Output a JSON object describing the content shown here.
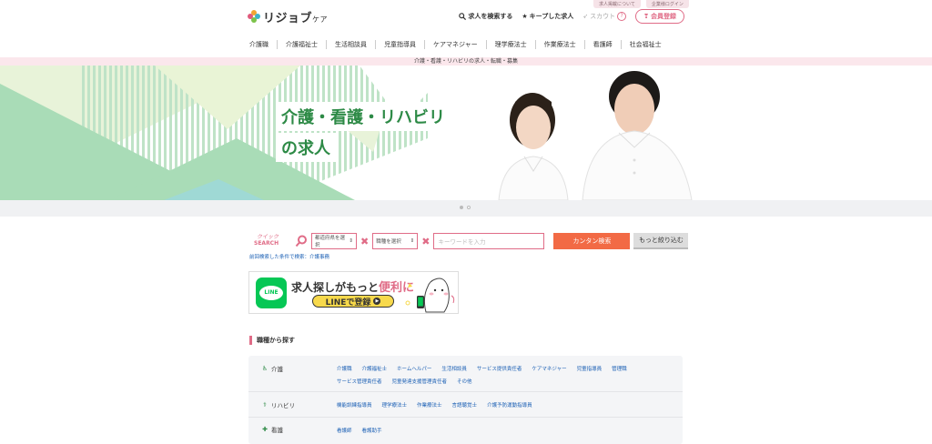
{
  "top_links": [
    "求人掲載について",
    "企業様ログイン"
  ],
  "header": {
    "logo_text": "リジョブ",
    "logo_sub": "ケア",
    "search_link": "求人を検索する",
    "keep_link": "キープした求人",
    "scout_link": "スカウト",
    "help_icon": "?",
    "register": "会員登録"
  },
  "nav": [
    "介護職",
    "介護福祉士",
    "生活相談員",
    "児童指導員",
    "ケアマネジャー",
    "理学療法士",
    "作業療法士",
    "看護師",
    "社会福祉士"
  ],
  "strip_text": "介護・看護・リハビリの求人・転職・募集",
  "hero": {
    "title_line1": "介護・看護・リハビリ",
    "title_line2": "の求人"
  },
  "search": {
    "quick_top": "クイック",
    "quick_bottom": "SEARCH",
    "area_select": "都道府県を選択",
    "job_select": "職種を選択",
    "keyword_placeholder": "キーワードを入力",
    "search_button": "カンタン検索",
    "more_button": "もっと絞り込む",
    "recent": "前回検索した条件で検索：介護事務"
  },
  "line_banner": {
    "logo": "LINE",
    "text_before": "求人探しがもっと",
    "text_highlight": "便利に",
    "button": "LINEで登録"
  },
  "section_title": "職種から探す",
  "categories": [
    {
      "name": "介護",
      "icon": "wheelchair-icon",
      "items": [
        "介護職",
        "介護福祉士",
        "ホームヘルパー",
        "生活相談員",
        "サービス提供責任者",
        "ケアマネジャー",
        "児童指導員",
        "管理職",
        "サービス管理責任者",
        "児童発達支援管理責任者",
        "その他"
      ]
    },
    {
      "name": "リハビリ",
      "icon": "rehab-icon",
      "items": [
        "機能訓練指導員",
        "理学療法士",
        "作業療法士",
        "言語聴覚士",
        "介護予防運動指導員"
      ]
    },
    {
      "name": "看護",
      "icon": "cross-icon",
      "items": [
        "看護師",
        "看護助手"
      ]
    }
  ],
  "colors": {
    "brand_pink": "#e06c87",
    "green": "#2d8a46",
    "search_orange": "#f26a45",
    "link_blue": "#1a5fb4",
    "line_green": "#06c755"
  }
}
